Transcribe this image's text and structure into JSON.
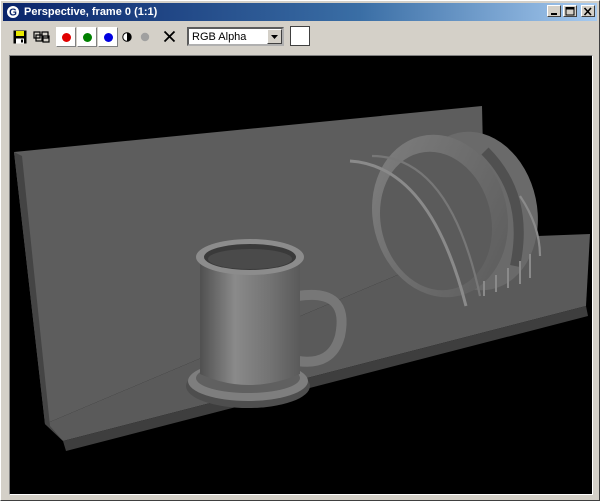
{
  "window": {
    "title": "Perspective, frame 0 (1:1)",
    "icon": "3dsmax-logo-icon",
    "minimize": "minimize-icon",
    "maximize": "maximize-icon",
    "close": "close-icon"
  },
  "toolbar": {
    "save": "save-icon",
    "clone": "clone-icon",
    "channels": [
      {
        "name": "red-channel",
        "color": "#e00000"
      },
      {
        "name": "green-channel",
        "color": "#008000"
      },
      {
        "name": "blue-channel",
        "color": "#0000e0"
      }
    ],
    "monochrome": "monochrome-icon",
    "alpha": "alpha-icon",
    "clear": "clear-icon",
    "channel_select": {
      "value": "RGB Alpha"
    },
    "color_swatch": "#ffffff"
  },
  "viewport": {
    "background": "#000000",
    "scene": "perspective render"
  }
}
